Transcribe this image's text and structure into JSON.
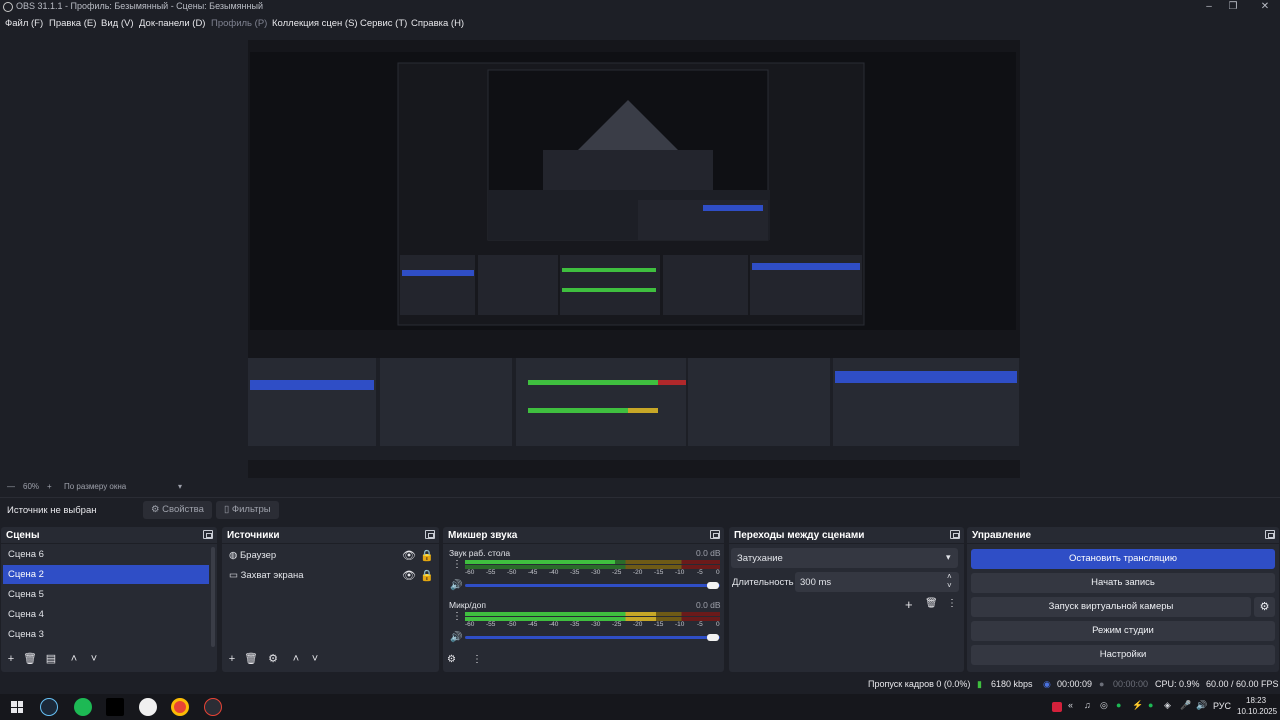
{
  "window": {
    "title": "OBS 31.1.1 - Профиль: Безымянный - Сцены: Безымянный"
  },
  "menu": [
    "Файл (F)",
    "Правка (E)",
    "Вид (V)",
    "Док-панели (D)",
    "Профиль (P)",
    "Коллекция сцен (S)",
    "Сервис (T)",
    "Справка (H)"
  ],
  "zoom": {
    "level": "60%",
    "mode": "По размеру окна"
  },
  "context": {
    "no_source": "Источник не выбран",
    "properties": "Свойства",
    "filters": "Фильтры"
  },
  "scenes": {
    "title": "Сцены",
    "items": [
      "Сцена 6",
      "Сцена 2",
      "Сцена 5",
      "Сцена 4",
      "Сцена 3"
    ],
    "selected_index": 1
  },
  "sources": {
    "title": "Источники",
    "items": [
      "Браузер",
      "Захват экрана"
    ]
  },
  "mixer": {
    "title": "Микшер звука",
    "channels": [
      {
        "name": "Звук раб. стола",
        "db": "0.0 dB"
      },
      {
        "name": "Микр/доп",
        "db": "0.0 dB"
      }
    ],
    "ticks": [
      "-60",
      "-55",
      "-50",
      "-45",
      "-40",
      "-35",
      "-30",
      "-25",
      "-20",
      "-15",
      "-10",
      "-5",
      "0"
    ]
  },
  "transitions": {
    "title": "Переходы между сценами",
    "type": "Затухание",
    "duration_label": "Длительность",
    "duration_value": "300 ms"
  },
  "controls": {
    "title": "Управление",
    "stop_stream": "Остановить трансляцию",
    "start_record": "Начать запись",
    "virtual_cam": "Запуск виртуальной камеры",
    "studio_mode": "Режим студии",
    "settings": "Настройки"
  },
  "status": {
    "dropped": "Пропуск кадров 0 (0.0%)",
    "bitrate": "6180 kbps",
    "stream_time": "00:00:09",
    "record_time": "00:00:00",
    "cpu": "CPU: 0.9%",
    "fps": "60.00 / 60.00 FPS"
  },
  "taskbar": {
    "lang": "РУС",
    "time": "18:23",
    "date": "10.10.2025"
  },
  "colors": {
    "accent": "#2f4ec6",
    "panel": "#272a33",
    "bg": "#1d1f26"
  }
}
